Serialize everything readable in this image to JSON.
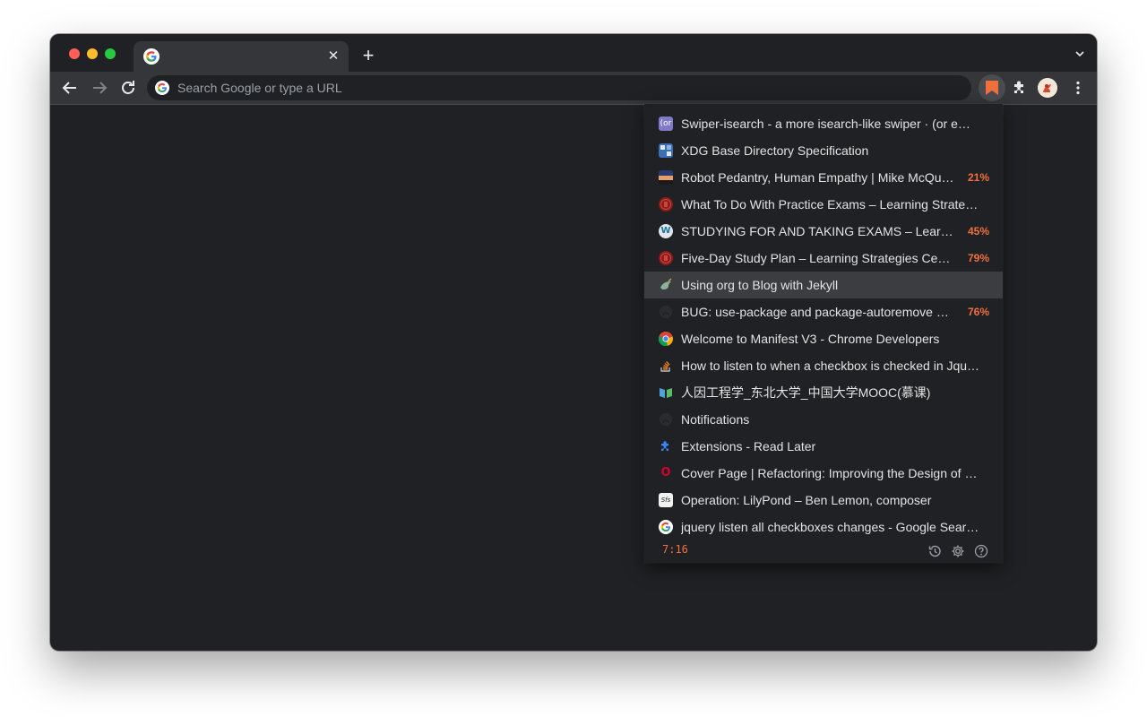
{
  "browser": {
    "tab": {
      "close_glyph": "✕"
    },
    "new_tab_glyph": "+",
    "omnibox": {
      "placeholder": "Search Google or type a URL",
      "value": ""
    }
  },
  "popup": {
    "items": [
      {
        "title": "Swiper-isearch - a more isearch-like swiper · (or e…",
        "percent": "",
        "favicon": "org-icon",
        "favicon_text": "(or"
      },
      {
        "title": "XDG Base Directory Specification",
        "percent": "",
        "favicon": "freedesktop-icon",
        "favicon_text": ""
      },
      {
        "title": "Robot Pedantry, Human Empathy | Mike McQu…",
        "percent": "21%",
        "favicon": "sunset-icon",
        "favicon_text": ""
      },
      {
        "title": "What To Do With Practice Exams – Learning Strate…",
        "percent": "",
        "favicon": "university-seal-icon",
        "favicon_text": ""
      },
      {
        "title": "STUDYING FOR AND TAKING EXAMS – Learni…",
        "percent": "45%",
        "favicon": "wordpress-icon",
        "favicon_text": "W"
      },
      {
        "title": "Five-Day Study Plan – Learning Strategies Cen…",
        "percent": "79%",
        "favicon": "university-seal-icon",
        "favicon_text": ""
      },
      {
        "title": "Using org to Blog with Jekyll",
        "percent": "",
        "favicon": "unicorn-icon",
        "favicon_text": ""
      },
      {
        "title": "BUG: use-package and package-autoremove …",
        "percent": "76%",
        "favicon": "github-icon",
        "favicon_text": ""
      },
      {
        "title": "Welcome to Manifest V3 - Chrome Developers",
        "percent": "",
        "favicon": "chrome-icon",
        "favicon_text": ""
      },
      {
        "title": "How to listen to when a checkbox is checked in Jqu…",
        "percent": "",
        "favicon": "stackoverflow-icon",
        "favicon_text": ""
      },
      {
        "title": "人因工程学_东北大学_中国大学MOOC(慕课)",
        "percent": "",
        "favicon": "mooc-icon",
        "favicon_text": ""
      },
      {
        "title": "Notifications",
        "percent": "",
        "favicon": "github-icon",
        "favicon_text": ""
      },
      {
        "title": "Extensions - Read Later",
        "percent": "",
        "favicon": "puzzle-icon",
        "favicon_text": ""
      },
      {
        "title": "Cover Page | Refactoring: Improving the Design of …",
        "percent": "",
        "favicon": "oreilly-icon",
        "favicon_text": "O"
      },
      {
        "title": "Operation: LilyPond – Ben Lemon, composer",
        "percent": "",
        "favicon": "sfs-icon",
        "favicon_text": "Sfs"
      },
      {
        "title": "jquery listen all checkboxes changes - Google Sear…",
        "percent": "",
        "favicon": "google-icon",
        "favicon_text": ""
      }
    ],
    "selected_index": 6,
    "footer": {
      "timer": "7:16"
    }
  },
  "colors": {
    "accent": "#f0703e",
    "window_bg": "#202124",
    "toolbar_bg": "#35363a",
    "selected_row": "#3c3d40"
  }
}
